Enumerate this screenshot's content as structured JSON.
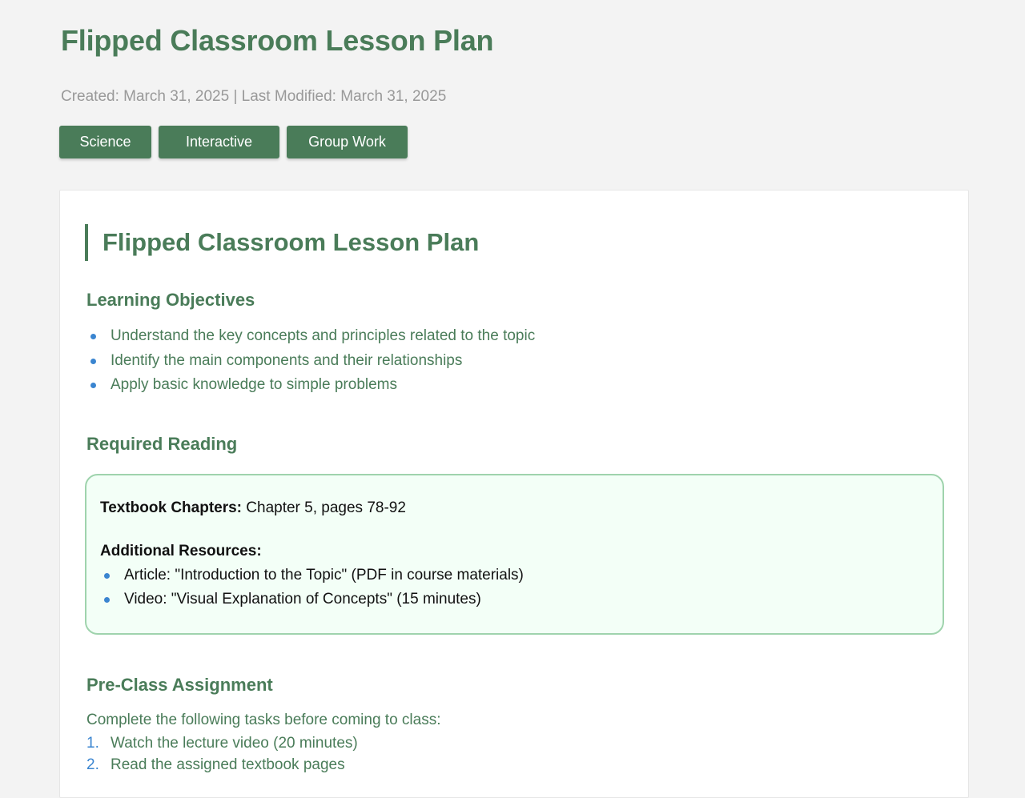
{
  "header": {
    "title": "Flipped Classroom Lesson Plan",
    "meta": "Created: March 31, 2025 | Last Modified: March 31, 2025",
    "tags": [
      "Science",
      "Interactive",
      "Group Work"
    ]
  },
  "card": {
    "title": "Flipped Classroom Lesson Plan",
    "objectives": {
      "heading": "Learning Objectives",
      "items": [
        "Understand the key concepts and principles related to the topic",
        "Identify the main components and their relationships",
        "Apply basic knowledge to simple problems"
      ]
    },
    "reading": {
      "heading": "Required Reading",
      "textbook_label": "Textbook Chapters:",
      "textbook_value": " Chapter 5, pages 78-92",
      "resources_label": "Additional Resources:",
      "resources": [
        "Article: \"Introduction to the Topic\" (PDF in course materials)",
        "Video: \"Visual Explanation of Concepts\" (15 minutes)"
      ]
    },
    "preclass": {
      "heading": "Pre-Class Assignment",
      "intro": "Complete the following tasks before coming to class:",
      "items": [
        {
          "num": "1.",
          "text": "Watch the lecture video (20 minutes)"
        },
        {
          "num": "2.",
          "text": "Read the assigned textbook pages"
        }
      ]
    }
  },
  "colors": {
    "accent": "#4a7c59",
    "bullet": "#3a85d0",
    "reading_bg": "#f3fff7",
    "reading_border": "#9fd3ad"
  }
}
